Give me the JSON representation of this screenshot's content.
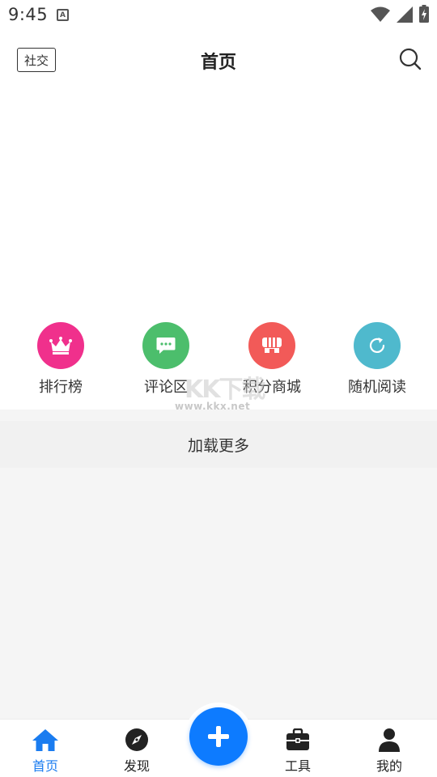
{
  "status_bar": {
    "time": "9:45",
    "notification_letter": "A",
    "icons": [
      "wifi-icon",
      "signal-icon",
      "battery-charging-icon"
    ]
  },
  "header": {
    "social_button": "社交",
    "title": "首页",
    "search_icon": "search-icon"
  },
  "quick_menu": [
    {
      "label": "排行榜",
      "icon": "crown-icon",
      "color": "#f0308c"
    },
    {
      "label": "评论区",
      "icon": "chat-bubble-icon",
      "color": "#4cbe6c"
    },
    {
      "label": "积分商城",
      "icon": "store-icon",
      "color": "#f25a58"
    },
    {
      "label": "随机阅读",
      "icon": "refresh-icon",
      "color": "#4fb9cd"
    }
  ],
  "watermark": {
    "text": "KK下载",
    "url": "www.kkx.net"
  },
  "load_more": "加载更多",
  "bottom_nav": {
    "items": [
      {
        "label": "首页",
        "icon": "home-icon",
        "active": true
      },
      {
        "label": "发现",
        "icon": "compass-icon",
        "active": false
      },
      {
        "label": "工具",
        "icon": "toolbox-icon",
        "active": false
      },
      {
        "label": "我的",
        "icon": "user-icon",
        "active": false
      }
    ],
    "fab_icon": "plus-icon"
  },
  "colors": {
    "accent": "#1a7cf0",
    "fab": "#0d7bff",
    "page_background": "#f5f5f5"
  }
}
